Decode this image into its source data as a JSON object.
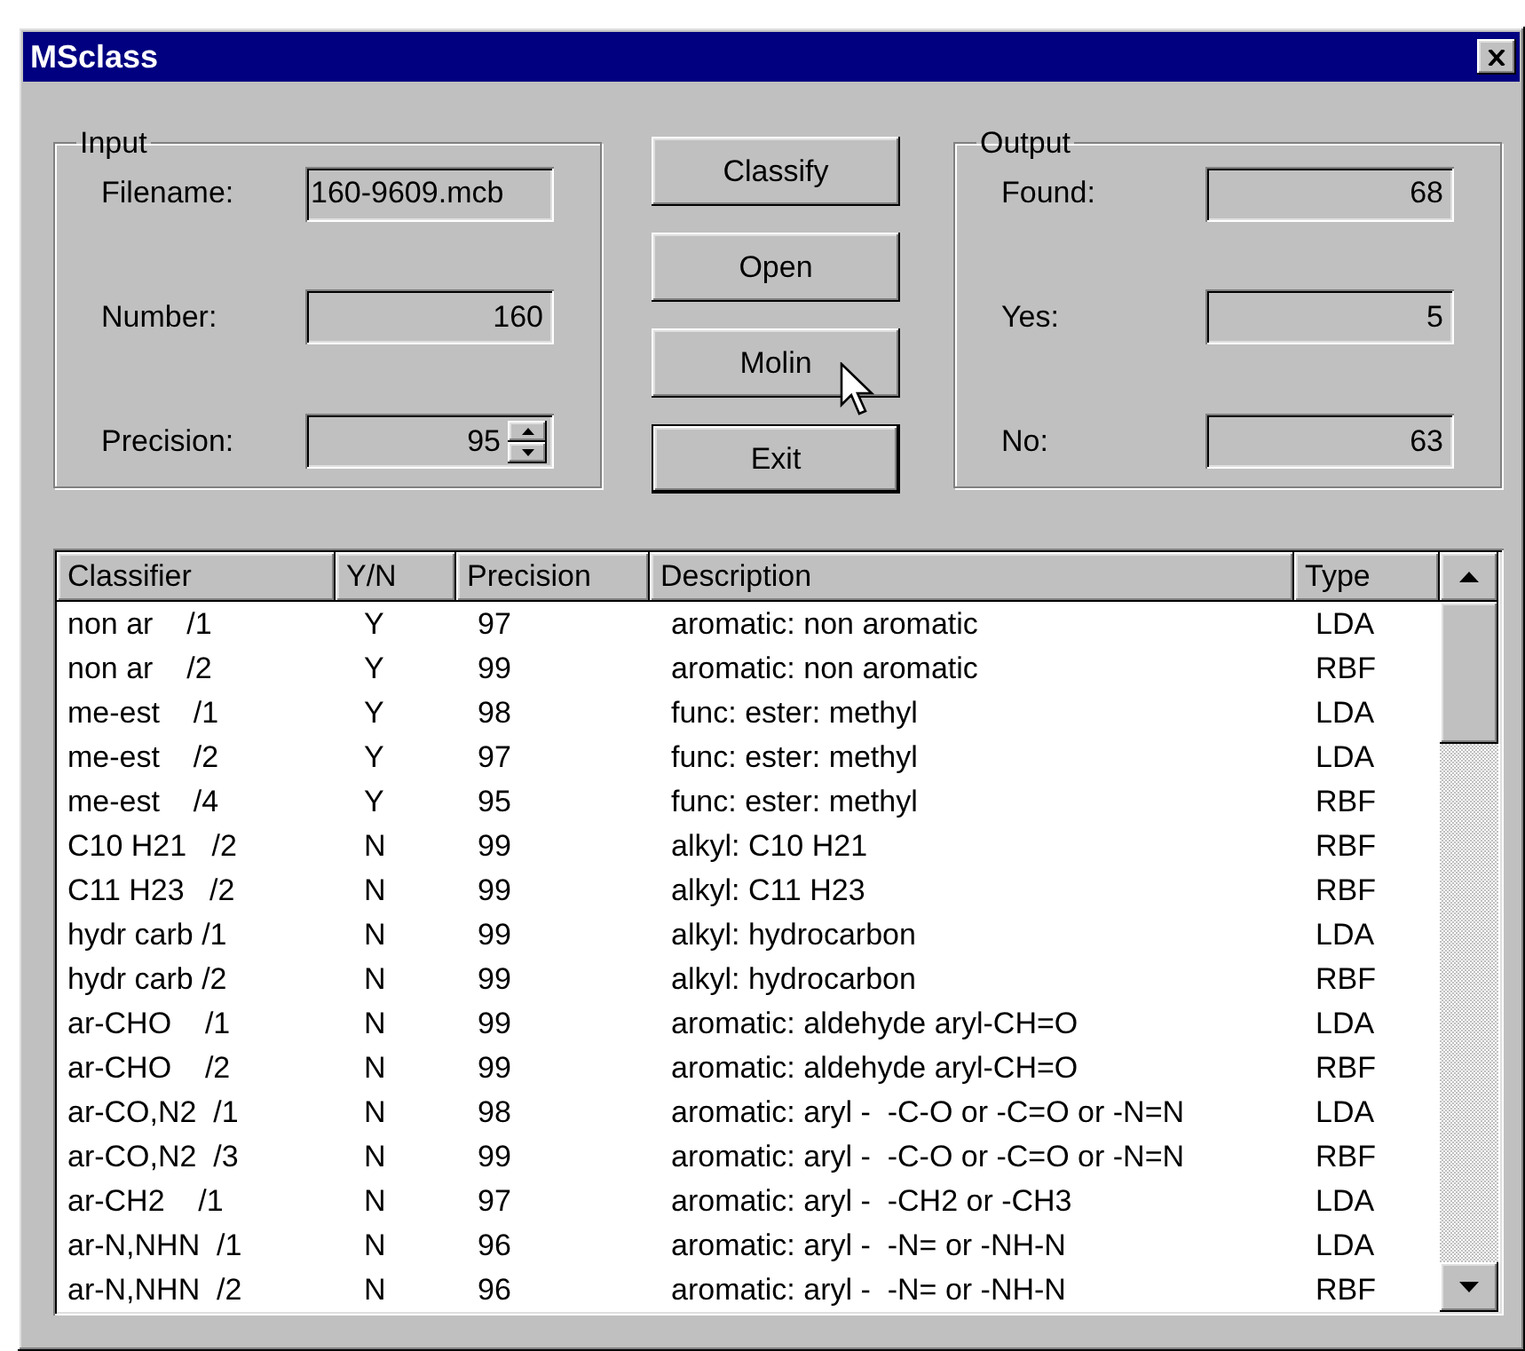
{
  "window": {
    "title": "MSclass"
  },
  "input": {
    "legend": "Input",
    "fields": [
      {
        "label": "Filename:",
        "value": "160-9609.mcb",
        "kind": "text"
      },
      {
        "label": "Number:",
        "value": "160",
        "kind": "number"
      },
      {
        "label": "Precision:",
        "value": "95",
        "kind": "spin"
      }
    ]
  },
  "buttons": [
    {
      "label": "Classify",
      "default": false
    },
    {
      "label": "Open",
      "default": false
    },
    {
      "label": "Molin",
      "default": false,
      "hovered": true
    },
    {
      "label": "Exit",
      "default": true
    }
  ],
  "output": {
    "legend": "Output",
    "fields": [
      {
        "label": "Found:",
        "value": "68"
      },
      {
        "label": "Yes:",
        "value": "5"
      },
      {
        "label": "No:",
        "value": "63"
      }
    ]
  },
  "table": {
    "columns": [
      "Classifier",
      "Y/N",
      "Precision",
      "Description",
      "Type"
    ],
    "rows": [
      [
        "non ar    /1",
        "Y",
        "97",
        "aromatic: non aromatic",
        "LDA"
      ],
      [
        "non ar    /2",
        "Y",
        "99",
        "aromatic: non aromatic",
        "RBF"
      ],
      [
        "me-est    /1",
        "Y",
        "98",
        "func: ester: methyl",
        "LDA"
      ],
      [
        "me-est    /2",
        "Y",
        "97",
        "func: ester: methyl",
        "LDA"
      ],
      [
        "me-est    /4",
        "Y",
        "95",
        "func: ester: methyl",
        "RBF"
      ],
      [
        "C10 H21   /2",
        "N",
        "99",
        "alkyl: C10 H21",
        "RBF"
      ],
      [
        "C11 H23   /2",
        "N",
        "99",
        "alkyl: C11 H23",
        "RBF"
      ],
      [
        "hydr carb /1",
        "N",
        "99",
        "alkyl: hydrocarbon",
        "LDA"
      ],
      [
        "hydr carb /2",
        "N",
        "99",
        "alkyl: hydrocarbon",
        "RBF"
      ],
      [
        "ar-CHO    /1",
        "N",
        "99",
        "aromatic: aldehyde aryl-CH=O",
        "LDA"
      ],
      [
        "ar-CHO    /2",
        "N",
        "99",
        "aromatic: aldehyde aryl-CH=O",
        "RBF"
      ],
      [
        "ar-CO,N2  /1",
        "N",
        "98",
        "aromatic: aryl -  -C-O or -C=O or -N=N",
        "LDA"
      ],
      [
        "ar-CO,N2  /3",
        "N",
        "99",
        "aromatic: aryl -  -C-O or -C=O or -N=N",
        "RBF"
      ],
      [
        "ar-CH2    /1",
        "N",
        "97",
        "aromatic: aryl -  -CH2 or -CH3",
        "LDA"
      ],
      [
        "ar-N,NHN  /1",
        "N",
        "96",
        "aromatic: aryl -  -N= or -NH-N",
        "LDA"
      ],
      [
        "ar-N,NHN  /2",
        "N",
        "96",
        "aromatic: aryl -  -N= or -NH-N",
        "RBF"
      ]
    ]
  }
}
